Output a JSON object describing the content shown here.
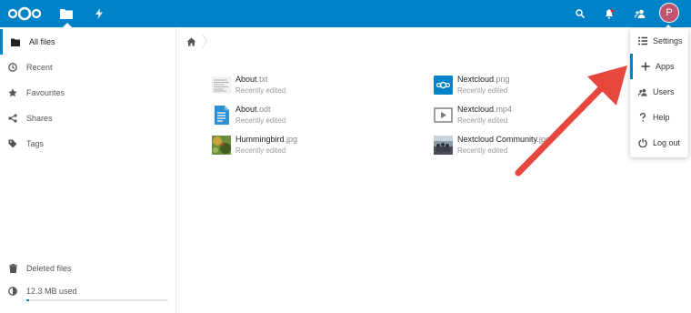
{
  "header": {
    "logo": "nextcloud-logo",
    "apps": [
      {
        "name": "files",
        "icon": "folder-icon",
        "active": true
      },
      {
        "name": "activity",
        "icon": "lightning-icon",
        "active": false
      }
    ],
    "actions": [
      {
        "name": "search",
        "icon": "search-icon"
      },
      {
        "name": "notifications",
        "icon": "bell-icon"
      },
      {
        "name": "contacts",
        "icon": "contacts-icon"
      }
    ],
    "avatar_letter": "P",
    "colors": {
      "brand": "#0082c9",
      "avatar": "#c0536d"
    }
  },
  "sidebar": {
    "items": [
      {
        "label": "All files",
        "icon": "folder-icon",
        "active": true
      },
      {
        "label": "Recent",
        "icon": "clock-icon"
      },
      {
        "label": "Favourites",
        "icon": "star-icon"
      },
      {
        "label": "Shares",
        "icon": "share-icon"
      },
      {
        "label": "Tags",
        "icon": "tag-icon"
      }
    ],
    "deleted_files": "Deleted files",
    "quota_label": "12.3 MB used",
    "quota_fraction": 0.02
  },
  "breadcrumb": {
    "home_icon": "home-icon"
  },
  "files": [
    {
      "base": "About",
      "ext": ".txt",
      "sub": "Recently edited",
      "icon": "text-file-icon"
    },
    {
      "base": "About",
      "ext": ".odt",
      "sub": "Recently edited",
      "icon": "document-icon"
    },
    {
      "base": "Hummingbird",
      "ext": ".jpg",
      "sub": "Recently edited",
      "icon": "image-thumbnail"
    },
    {
      "base": "Nextcloud",
      "ext": ".png",
      "sub": "Recently edited",
      "icon": "nextcloud-thumbnail"
    },
    {
      "base": "Nextcloud",
      "ext": ".mp4",
      "sub": "Recently edited",
      "icon": "video-icon"
    },
    {
      "base": "Nextcloud Community",
      "ext": ".jpg",
      "sub": "Recently edited",
      "icon": "image-thumbnail"
    }
  ],
  "menu": {
    "items": [
      {
        "label": "Settings",
        "icon": "settings-list-icon"
      },
      {
        "label": "Apps",
        "icon": "plus-icon",
        "active": true
      },
      {
        "label": "Users",
        "icon": "users-icon"
      },
      {
        "label": "Help",
        "icon": "help-icon"
      },
      {
        "label": "Log out",
        "icon": "power-icon"
      }
    ]
  },
  "annotation": {
    "arrow_color": "#e8473e"
  }
}
